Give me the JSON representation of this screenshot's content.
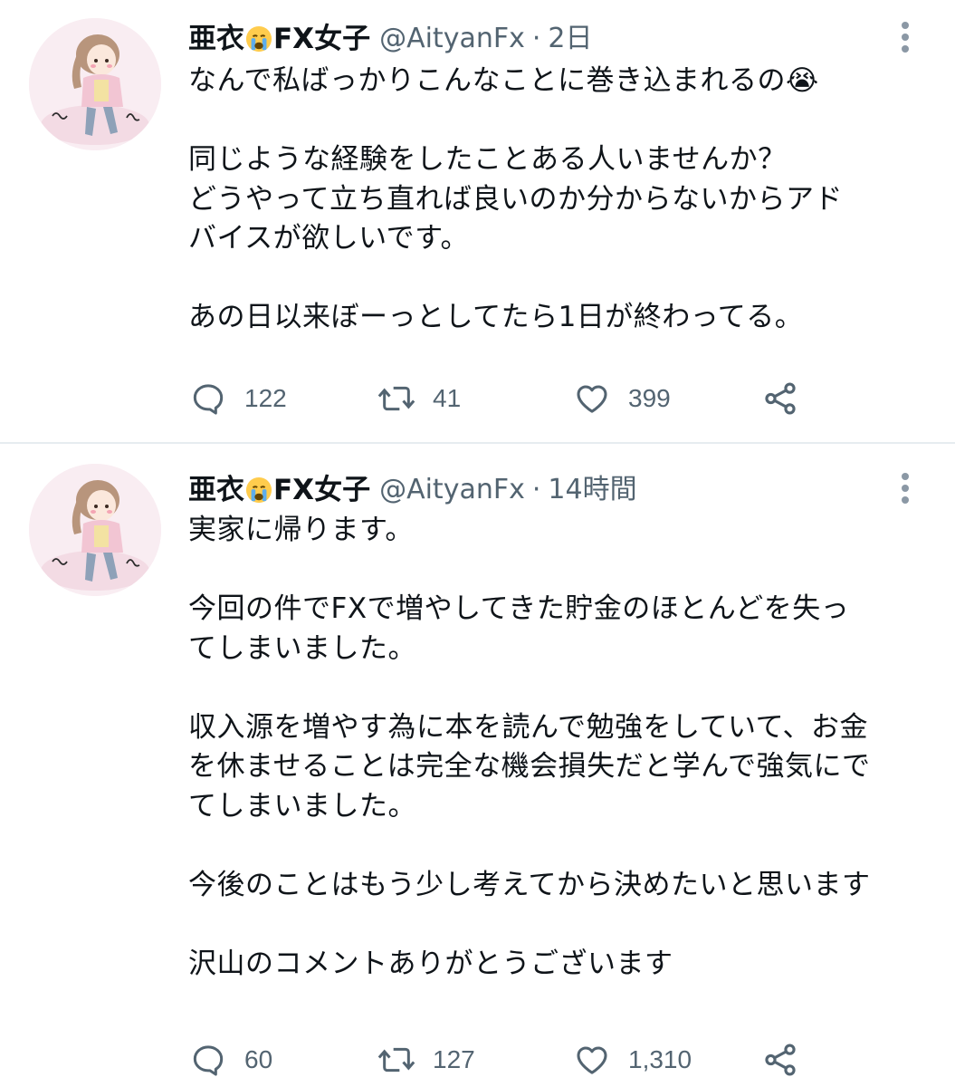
{
  "tweets": [
    {
      "author_name": "亜衣",
      "author_suffix": "FX女子",
      "emoji": "crying-face",
      "handle": "@AityanFx",
      "separator": "·",
      "time": "2日",
      "lines": [
        "なんで私ばっかりこんなことに巻き込まれるの😭",
        "",
        "同じような経験をしたことある人いませんか？",
        "どうやって立ち直れば良いのか分からないからアド",
        "バイスが欲しいです。",
        "",
        "あの日以来ぼーっとしてたら1日が終わってる。"
      ],
      "reply_count": "122",
      "retweet_count": "41",
      "like_count": "399"
    },
    {
      "author_name": "亜衣",
      "author_suffix": "FX女子",
      "emoji": "crying-face",
      "handle": "@AityanFx",
      "separator": "·",
      "time": "14時間",
      "lines": [
        "実家に帰ります。",
        "",
        "今回の件でFXで増やしてきた貯金のほとんどを失っ",
        "てしまいました。",
        "",
        "収入源を増やす為に本を読んで勉強をしていて、お金",
        "を休ませることは完全な機会損失だと学んで強気にで",
        "てしまいました。",
        "",
        "今後のことはもう少し考えてから決めたいと思います",
        "",
        "沢山のコメントありがとうございます"
      ],
      "reply_count": "60",
      "retweet_count": "127",
      "like_count": "1,310"
    }
  ],
  "colors": {
    "text": "#0f1419",
    "secondary": "#536471",
    "divider": "#e6ecf0",
    "avatar_bg": "#f7e9ef"
  },
  "icons": [
    "reply-icon",
    "retweet-icon",
    "like-icon",
    "share-icon",
    "more-options-icon",
    "crying-face-emoji"
  ]
}
